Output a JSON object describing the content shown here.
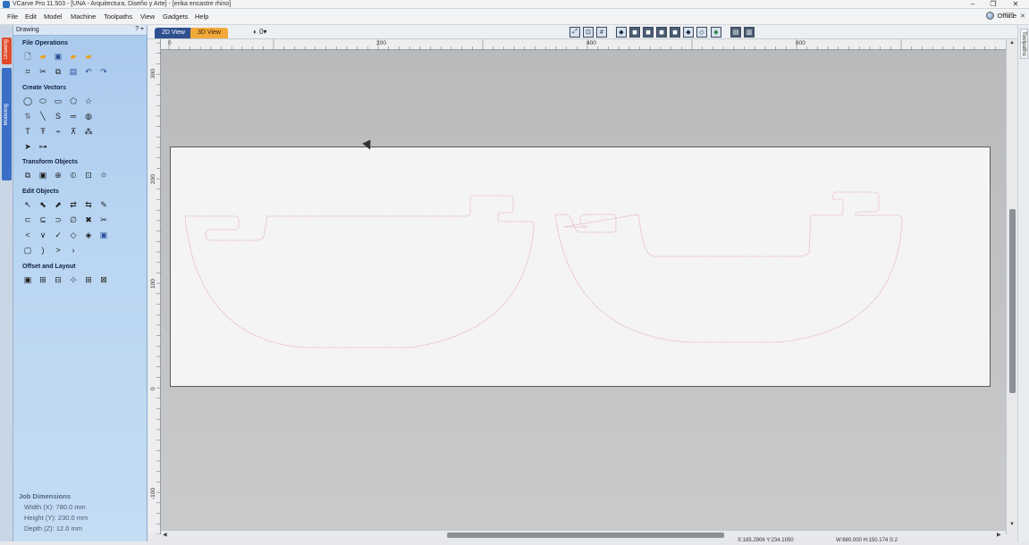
{
  "window": {
    "title": "VCarve Pro 11.503 - [UNA - Arquitectura, Diseño y Arte] - [erika encastre rhino]",
    "minimize": "–",
    "restore": "❐",
    "close": "✕"
  },
  "menu": {
    "items": [
      "File",
      "Edit",
      "Model",
      "Machine",
      "Toolpaths",
      "View",
      "Gadgets",
      "Help"
    ],
    "status": "Offline"
  },
  "left_panel": {
    "header": "Drawing",
    "header_controls": "? ⌖",
    "sections": [
      "File Operations",
      "Create Vectors",
      "Transform Objects",
      "Edit Objects",
      "Offset and Layout"
    ],
    "job_dimensions": {
      "title": "Job Dimensions",
      "width": "Width  (X): 780.0 mm",
      "height": "Height (Y): 230.0 mm",
      "depth": "Depth  (Z): 12.0 mm"
    }
  },
  "side_tabs": {
    "drawing": "Drawing",
    "modeling": "Modeling"
  },
  "right_tabs": {
    "toolpaths": "Toolpaths"
  },
  "view_tabs": {
    "two_d": "2D View",
    "three_d": "3D View",
    "layer": "0"
  },
  "rulers": {
    "top": [
      "0",
      "200",
      "400",
      "600"
    ],
    "left": [
      "300",
      "200",
      "100",
      "0",
      "-100"
    ]
  },
  "statusbar": {
    "coords": "X:185.2906 Y:234.1050",
    "dims": "W:680.000  H:150.174  S:2"
  },
  "colors": {
    "panel_blue": "#b9d5f2",
    "canvas_gray": "#c1c2c4",
    "material": "#f4f4f4",
    "vector_outline": "#e39ab8",
    "tab_2d": "#2f4f8f",
    "tab_3d": "#f2a93b"
  }
}
